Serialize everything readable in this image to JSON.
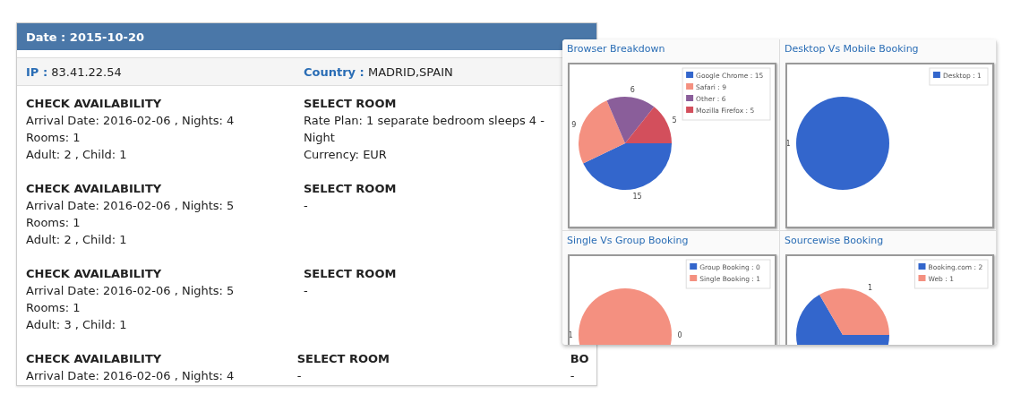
{
  "card": {
    "date_label": "Date :",
    "date": "2015-10-20",
    "ip_label": "IP :",
    "ip": "83.41.22.54",
    "country_label": "Country :",
    "country": "MADRID,SPAIN",
    "entries": [
      {
        "check": {
          "heading": "CHECK AVAILABILITY",
          "lines": [
            "Arrival Date: 2016-02-06 , Nights: 4",
            "Rooms: 1",
            "Adult: 2 , Child: 1"
          ]
        },
        "select": {
          "heading": "SELECT ROOM",
          "lines": [
            "Rate Plan: 1 separate bedroom sleeps 4 - Night",
            "Currency: EUR"
          ]
        }
      },
      {
        "check": {
          "heading": "CHECK AVAILABILITY",
          "lines": [
            "Arrival Date: 2016-02-06 , Nights: 5",
            "Rooms: 1",
            "Adult: 2 , Child: 1"
          ]
        },
        "select": {
          "heading": "SELECT ROOM",
          "lines": [
            "-"
          ]
        }
      },
      {
        "check": {
          "heading": "CHECK AVAILABILITY",
          "lines": [
            "Arrival Date: 2016-02-06 , Nights: 5",
            "Rooms: 1",
            "Adult: 3 , Child: 1"
          ]
        },
        "select": {
          "heading": "SELECT ROOM",
          "lines": [
            "-"
          ]
        }
      },
      {
        "check": {
          "heading": "CHECK AVAILABILITY",
          "lines": [
            "Arrival Date: 2016-02-06 , Nights: 4"
          ]
        },
        "select": {
          "heading": "SELECT ROOM",
          "lines": [
            "-"
          ]
        },
        "column_3": {
          "heading": "BO",
          "lines": [
            "-"
          ]
        }
      }
    ]
  },
  "charts_panel": {
    "panels": [
      {
        "chart_data": {
          "type": "pie",
          "title": "Browser Breakdown",
          "categories": [
            "Google Chrome : 15",
            "Safari : 9",
            "Other : 6",
            "Mozilla Firefox : 5"
          ],
          "values": [
            15,
            9,
            6,
            5
          ],
          "colors": [
            "#3366cc",
            "#f49080",
            "#8a5e9a",
            "#d34f5c"
          ],
          "value_labels": [
            "15",
            "9",
            "6",
            "5"
          ],
          "data_labels": true,
          "legend": "top-right"
        }
      },
      {
        "chart_data": {
          "type": "pie",
          "title": "Desktop Vs Mobile Booking",
          "categories": [
            "Desktop : 1"
          ],
          "values": [
            1
          ],
          "colors": [
            "#3366cc"
          ],
          "value_labels": [
            "1"
          ],
          "data_labels": true,
          "legend": "top-right"
        }
      },
      {
        "chart_data": {
          "type": "pie",
          "title": "Single Vs Group Booking",
          "categories": [
            "Group Booking : 0",
            "Single Booking : 1"
          ],
          "values": [
            0,
            1
          ],
          "colors": [
            "#3366cc",
            "#f49080"
          ],
          "value_labels": [
            "0",
            "1"
          ],
          "data_labels": true,
          "legend": "top-right"
        }
      },
      {
        "chart_data": {
          "type": "pie",
          "title": "Sourcewise Booking",
          "categories": [
            "Booking.com : 2",
            "Web : 1"
          ],
          "values": [
            2,
            1
          ],
          "colors": [
            "#3366cc",
            "#f49080"
          ],
          "value_labels": [
            null,
            "1"
          ],
          "data_labels": true,
          "legend": "top-right"
        }
      }
    ]
  }
}
